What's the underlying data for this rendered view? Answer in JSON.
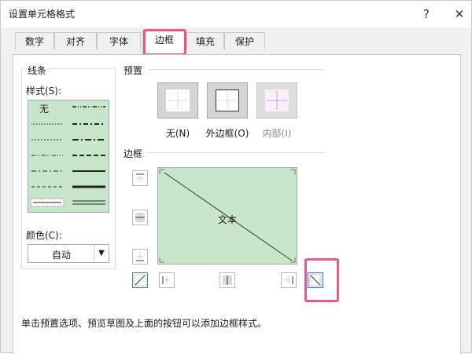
{
  "window": {
    "title": "设置单元格格式",
    "help_label": "?",
    "close_label": "✕"
  },
  "tabs": [
    {
      "label": "数字"
    },
    {
      "label": "对齐"
    },
    {
      "label": "字体"
    },
    {
      "label": "边框",
      "active": true
    },
    {
      "label": "填充"
    },
    {
      "label": "保护"
    }
  ],
  "line": {
    "section_label": "线条",
    "style_label": "样式(S):",
    "none_label": "无",
    "color_label": "颜色(C):",
    "color_value": "自动",
    "style_colors": {
      "background": "#c8e6c9"
    }
  },
  "presets": {
    "section_label": "预置",
    "items": [
      {
        "label": "无(N)",
        "enabled": true
      },
      {
        "label": "外边框(O)",
        "enabled": true
      },
      {
        "label": "内部(I)",
        "enabled": false
      }
    ]
  },
  "border": {
    "section_label": "边框",
    "preview_text": "文本"
  },
  "hint_text": "单击预置选项、预览草图及上面的按钮可以添加边框样式。",
  "colors": {
    "highlight": "#e8588a",
    "preview_bg": "#c8e6c9"
  }
}
